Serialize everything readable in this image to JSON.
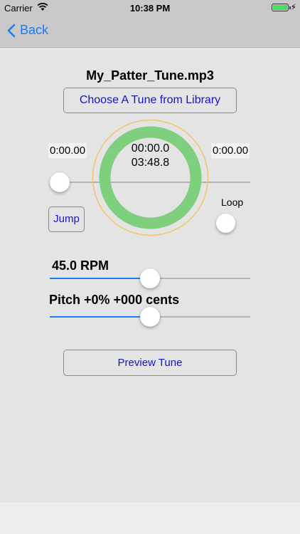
{
  "status_bar": {
    "carrier": "Carrier",
    "time": "10:38 PM",
    "bolt": "⚡"
  },
  "nav": {
    "back_label": "Back"
  },
  "player": {
    "filename": "My_Patter_Tune.mp3",
    "choose_label": "Choose A Tune from Library",
    "current_time": "00:00.0",
    "total_time": "03:48.8",
    "left_time": "0:00.00",
    "right_time": "0:00.00",
    "jump_label": "Jump",
    "loop_label": "Loop",
    "ring_progress": 1.0,
    "position_fraction": 0.0
  },
  "controls": {
    "rpm_label": "45.0 RPM",
    "rpm_fraction": 0.5,
    "pitch_label": "Pitch +0% +000 cents",
    "pitch_fraction": 0.5,
    "preview_label": "Preview Tune"
  },
  "colors": {
    "accent": "#1a7cf5",
    "ring": "#7ecf7e",
    "ring_outer": "#f5c36b",
    "button_text": "#1515c8"
  }
}
